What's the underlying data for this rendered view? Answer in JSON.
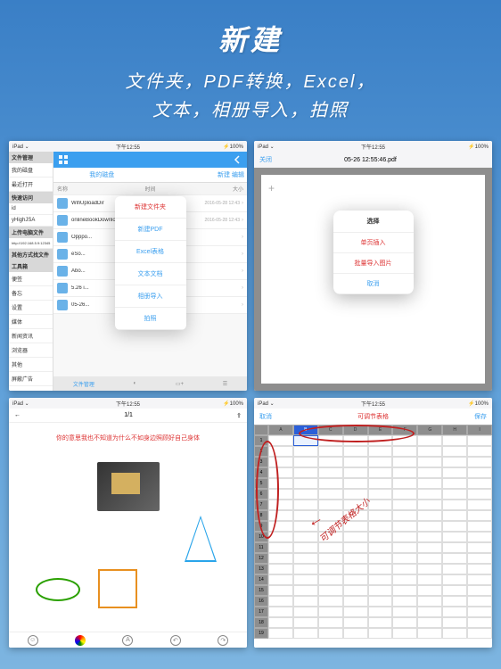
{
  "hero": {
    "title": "新建",
    "line1": "文件夹，PDF转换，Excel，",
    "line2": "文本，相册导入，拍照"
  },
  "status": {
    "left": "iPad ⌄",
    "time": "下午12:55",
    "batt": "⚡100%"
  },
  "s1": {
    "side": {
      "hdr1": "文件管理",
      "items1": [
        "我的磁盘",
        "最近打开"
      ],
      "hdr2": "快速访问",
      "items2": [
        "id",
        "...",
        "yHighJSA",
        "..."
      ],
      "hdr3": "上传电脑文件",
      "items3": [
        "http://192.168.5.9:12345"
      ],
      "hdr4": "其他方式找文件",
      "hdr5": "工具箱",
      "tools": [
        "便签",
        "备忘",
        "设置",
        "..."
      ],
      "misc": [
        "媒体",
        "新闻资讯",
        "浏览器",
        "其他",
        "屏蔽广告"
      ]
    },
    "tabs": {
      "left": "我的磁盘",
      "right": "新建  编辑"
    },
    "cols": [
      "名称",
      "时间",
      "大小"
    ],
    "rows": [
      {
        "name": "WifiUploadDir",
        "date": "2016-05-28 12:43"
      },
      {
        "name": "onlineBookDownloa...",
        "date": "2016-05-28 12:43"
      },
      {
        "name": "Opppo...",
        "date": ""
      },
      {
        "name": "eSo...",
        "date": ""
      },
      {
        "name": "Abo...",
        "date": ""
      },
      {
        "name": "5.26 i...",
        "date": ""
      },
      {
        "name": "05-26...",
        "date": ""
      }
    ],
    "popup": [
      "新建文件夹",
      "新建PDF",
      "Excel表格",
      "文本文档",
      "相册导入",
      "拍照"
    ],
    "bottom": [
      "文件管理",
      "",
      "",
      ""
    ]
  },
  "s2": {
    "close": "关闭",
    "title": "05-26 12:55:46.pdf",
    "popup": {
      "title": "选择",
      "items": [
        "单页插入",
        "批量导入图片"
      ],
      "cancel": "取消"
    }
  },
  "s3": {
    "left": "←",
    "title": "1/1",
    "text": "你的意思我也不知道为什么不如身边照顾好自己身体"
  },
  "s4": {
    "cancel": "取消",
    "title": "可调节表格",
    "save": "保存",
    "cols": [
      "A",
      "B",
      "C",
      "D",
      "E",
      "F",
      "G",
      "H",
      "I"
    ],
    "annotation": "可调节表格大小"
  }
}
